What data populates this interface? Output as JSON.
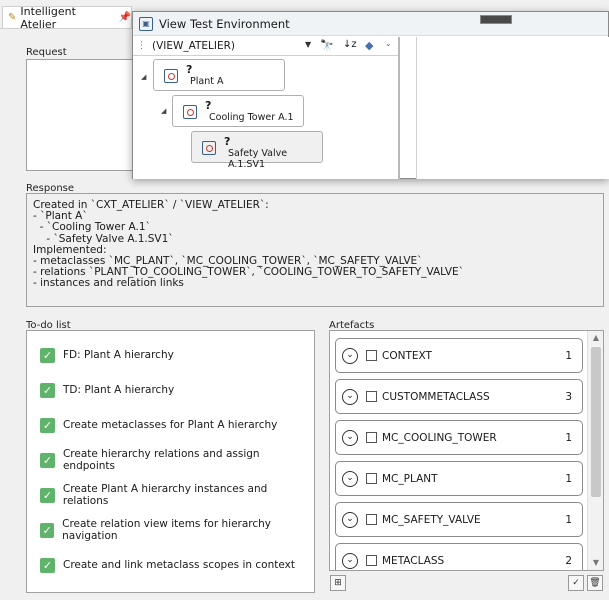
{
  "tab": {
    "title": "Intelligent Atelier"
  },
  "request": {
    "label": "Request"
  },
  "response": {
    "label": "Response",
    "lines": [
      "Created in `CXT_ATELIER` / `VIEW_ATELIER`:",
      "",
      "- `Plant A`",
      "  - `Cooling Tower A.1`",
      "    - `Safety Valve A.1.SV1`",
      "",
      "Implemented:",
      "- metaclasses `MC_PLANT`, `MC_COOLING_TOWER`, `MC_SAFETY_VALVE`",
      "- relations `PLANT_TO_COOLING_TOWER`, `COOLING_TOWER_TO_SAFETY_VALVE`",
      "- instances and relation links"
    ]
  },
  "todo": {
    "label": "To-do list",
    "items": [
      "FD: Plant A hierarchy",
      "TD: Plant A hierarchy",
      "Create metaclasses for Plant A hierarchy",
      "Create hierarchy relations and assign endpoints",
      "Create Plant A hierarchy instances and relations",
      "Create relation view items for hierarchy navigation",
      "Create and link metaclass scopes in context"
    ]
  },
  "artefacts": {
    "label": "Artefacts",
    "items": [
      {
        "name": "CONTEXT",
        "count": "1"
      },
      {
        "name": "CUSTOMMETACLASS",
        "count": "3"
      },
      {
        "name": "MC_COOLING_TOWER",
        "count": "1"
      },
      {
        "name": "MC_PLANT",
        "count": "1"
      },
      {
        "name": "MC_SAFETY_VALVE",
        "count": "1"
      },
      {
        "name": "METACLASS",
        "count": "2"
      }
    ]
  },
  "popup": {
    "title": "View Test Environment",
    "view_selector": "(VIEW_ATELIER)",
    "nodes": [
      {
        "q": "?",
        "label": "Plant A"
      },
      {
        "q": "?",
        "label": "Cooling Tower A.1"
      },
      {
        "q": "?",
        "label": "Safety Valve A.1.SV1"
      }
    ]
  },
  "colors": {
    "check_green": "#5fb36a",
    "accent_blue": "#3a5f88"
  }
}
